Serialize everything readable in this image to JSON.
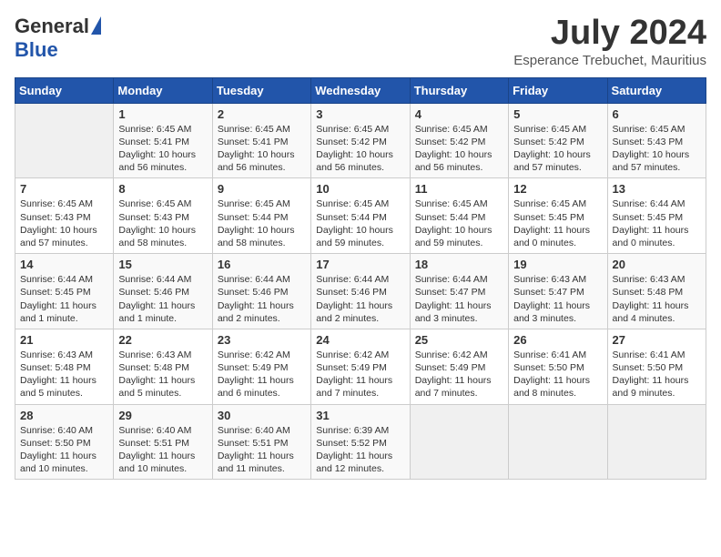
{
  "logo": {
    "general": "General",
    "blue": "Blue"
  },
  "title": "July 2024",
  "location": "Esperance Trebuchet, Mauritius",
  "days_of_week": [
    "Sunday",
    "Monday",
    "Tuesday",
    "Wednesday",
    "Thursday",
    "Friday",
    "Saturday"
  ],
  "weeks": [
    [
      {
        "day": "",
        "info": ""
      },
      {
        "day": "1",
        "info": "Sunrise: 6:45 AM\nSunset: 5:41 PM\nDaylight: 10 hours\nand 56 minutes."
      },
      {
        "day": "2",
        "info": "Sunrise: 6:45 AM\nSunset: 5:41 PM\nDaylight: 10 hours\nand 56 minutes."
      },
      {
        "day": "3",
        "info": "Sunrise: 6:45 AM\nSunset: 5:42 PM\nDaylight: 10 hours\nand 56 minutes."
      },
      {
        "day": "4",
        "info": "Sunrise: 6:45 AM\nSunset: 5:42 PM\nDaylight: 10 hours\nand 56 minutes."
      },
      {
        "day": "5",
        "info": "Sunrise: 6:45 AM\nSunset: 5:42 PM\nDaylight: 10 hours\nand 57 minutes."
      },
      {
        "day": "6",
        "info": "Sunrise: 6:45 AM\nSunset: 5:43 PM\nDaylight: 10 hours\nand 57 minutes."
      }
    ],
    [
      {
        "day": "7",
        "info": "Sunrise: 6:45 AM\nSunset: 5:43 PM\nDaylight: 10 hours\nand 57 minutes."
      },
      {
        "day": "8",
        "info": "Sunrise: 6:45 AM\nSunset: 5:43 PM\nDaylight: 10 hours\nand 58 minutes."
      },
      {
        "day": "9",
        "info": "Sunrise: 6:45 AM\nSunset: 5:44 PM\nDaylight: 10 hours\nand 58 minutes."
      },
      {
        "day": "10",
        "info": "Sunrise: 6:45 AM\nSunset: 5:44 PM\nDaylight: 10 hours\nand 59 minutes."
      },
      {
        "day": "11",
        "info": "Sunrise: 6:45 AM\nSunset: 5:44 PM\nDaylight: 10 hours\nand 59 minutes."
      },
      {
        "day": "12",
        "info": "Sunrise: 6:45 AM\nSunset: 5:45 PM\nDaylight: 11 hours\nand 0 minutes."
      },
      {
        "day": "13",
        "info": "Sunrise: 6:44 AM\nSunset: 5:45 PM\nDaylight: 11 hours\nand 0 minutes."
      }
    ],
    [
      {
        "day": "14",
        "info": "Sunrise: 6:44 AM\nSunset: 5:45 PM\nDaylight: 11 hours\nand 1 minute."
      },
      {
        "day": "15",
        "info": "Sunrise: 6:44 AM\nSunset: 5:46 PM\nDaylight: 11 hours\nand 1 minute."
      },
      {
        "day": "16",
        "info": "Sunrise: 6:44 AM\nSunset: 5:46 PM\nDaylight: 11 hours\nand 2 minutes."
      },
      {
        "day": "17",
        "info": "Sunrise: 6:44 AM\nSunset: 5:46 PM\nDaylight: 11 hours\nand 2 minutes."
      },
      {
        "day": "18",
        "info": "Sunrise: 6:44 AM\nSunset: 5:47 PM\nDaylight: 11 hours\nand 3 minutes."
      },
      {
        "day": "19",
        "info": "Sunrise: 6:43 AM\nSunset: 5:47 PM\nDaylight: 11 hours\nand 3 minutes."
      },
      {
        "day": "20",
        "info": "Sunrise: 6:43 AM\nSunset: 5:48 PM\nDaylight: 11 hours\nand 4 minutes."
      }
    ],
    [
      {
        "day": "21",
        "info": "Sunrise: 6:43 AM\nSunset: 5:48 PM\nDaylight: 11 hours\nand 5 minutes."
      },
      {
        "day": "22",
        "info": "Sunrise: 6:43 AM\nSunset: 5:48 PM\nDaylight: 11 hours\nand 5 minutes."
      },
      {
        "day": "23",
        "info": "Sunrise: 6:42 AM\nSunset: 5:49 PM\nDaylight: 11 hours\nand 6 minutes."
      },
      {
        "day": "24",
        "info": "Sunrise: 6:42 AM\nSunset: 5:49 PM\nDaylight: 11 hours\nand 7 minutes."
      },
      {
        "day": "25",
        "info": "Sunrise: 6:42 AM\nSunset: 5:49 PM\nDaylight: 11 hours\nand 7 minutes."
      },
      {
        "day": "26",
        "info": "Sunrise: 6:41 AM\nSunset: 5:50 PM\nDaylight: 11 hours\nand 8 minutes."
      },
      {
        "day": "27",
        "info": "Sunrise: 6:41 AM\nSunset: 5:50 PM\nDaylight: 11 hours\nand 9 minutes."
      }
    ],
    [
      {
        "day": "28",
        "info": "Sunrise: 6:40 AM\nSunset: 5:50 PM\nDaylight: 11 hours\nand 10 minutes."
      },
      {
        "day": "29",
        "info": "Sunrise: 6:40 AM\nSunset: 5:51 PM\nDaylight: 11 hours\nand 10 minutes."
      },
      {
        "day": "30",
        "info": "Sunrise: 6:40 AM\nSunset: 5:51 PM\nDaylight: 11 hours\nand 11 minutes."
      },
      {
        "day": "31",
        "info": "Sunrise: 6:39 AM\nSunset: 5:52 PM\nDaylight: 11 hours\nand 12 minutes."
      },
      {
        "day": "",
        "info": ""
      },
      {
        "day": "",
        "info": ""
      },
      {
        "day": "",
        "info": ""
      }
    ]
  ]
}
